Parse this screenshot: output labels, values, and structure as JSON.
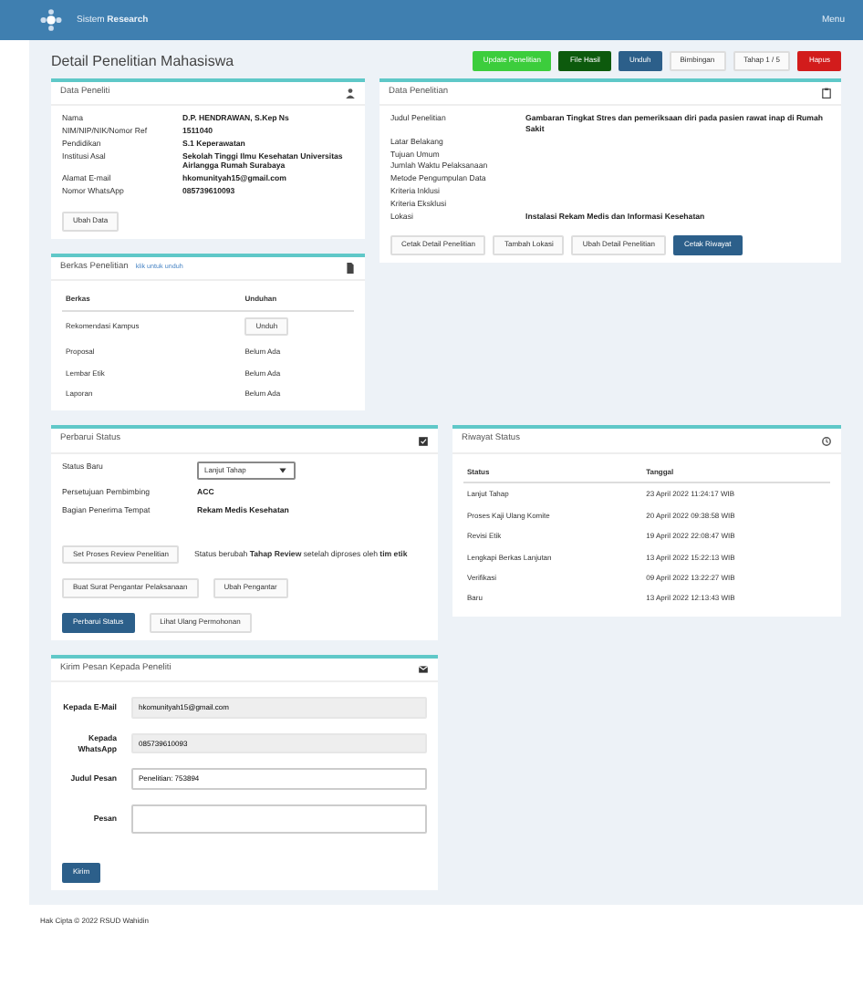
{
  "navbar": {
    "brand": "Sistem",
    "brand_bold": "Research",
    "menu": "Menu"
  },
  "page_title": "Detail Penelitian Mahasiswa",
  "actions": [
    {
      "label": "Update Penelitian",
      "kind": "success"
    },
    {
      "label": "File Hasil",
      "kind": "dark-success"
    },
    {
      "label": "Unduh",
      "kind": "primary"
    },
    {
      "label": "Bimbingan",
      "kind": "light"
    },
    {
      "label": "Tahap 1 / 5",
      "kind": "light"
    },
    {
      "label": "Hapus",
      "kind": "danger"
    }
  ],
  "researcher": {
    "title": "Data Peneliti",
    "fields": [
      {
        "label": "Nama",
        "value": "D.P. HENDRAWAN, S.Kep Ns"
      },
      {
        "label": "NIM/NIP/NIK/Nomor Ref",
        "value": "1511040"
      },
      {
        "label": "Pendidikan",
        "value": "S.1 Keperawatan"
      },
      {
        "label": "Institusi Asal",
        "value": "Sekolah Tinggi Ilmu Kesehatan Universitas Airlangga Rumah Surabaya"
      },
      {
        "label": "Alamat E-mail",
        "value": "hkomunityah15@gmail.com"
      },
      {
        "label": "Nomor WhatsApp",
        "value": "085739610093"
      }
    ],
    "edit_button": "Ubah Data"
  },
  "research": {
    "title": "Data Penelitian",
    "fields": [
      {
        "label": "Judul Penelitian",
        "value": "Gambaran Tingkat Stres dan pemeriksaan diri pada pasien rawat inap di Rumah Sakit"
      },
      {
        "label": "Latar Belakang"
      },
      {
        "label": "Tujuan Umum"
      },
      {
        "label": "Jumlah Waktu Pelaksanaan"
      },
      {
        "label": "Metode Pengumpulan Data"
      },
      {
        "label": "Kriteria Inklusi"
      },
      {
        "label": "Kriteria Eksklusi"
      },
      {
        "label": "Lokasi",
        "value": "Instalasi Rekam Medis dan Informasi Kesehatan"
      }
    ],
    "buttons": [
      {
        "label": "Cetak Detail Penelitian",
        "kind": "light"
      },
      {
        "label": "Tambah Lokasi",
        "kind": "light"
      },
      {
        "label": "Ubah Detail Penelitian",
        "kind": "light"
      },
      {
        "label": "Cetak Riwayat",
        "kind": "primary"
      }
    ]
  },
  "documents": {
    "title": "Berkas Penelitian",
    "subtitle": "klik untuk unduh",
    "columns": [
      "Berkas",
      "Unduhan"
    ],
    "rows": [
      {
        "name": "Rekomendasi Kampus",
        "file": "Unduh",
        "kind": "button"
      },
      {
        "name": "Proposal",
        "file": "Belum Ada",
        "kind": "text"
      },
      {
        "name": "Lembar Etik",
        "file": "Belum Ada",
        "kind": "text"
      },
      {
        "name": "Laporan",
        "file": "Belum Ada",
        "kind": "text"
      }
    ]
  },
  "status_update": {
    "title": "Perbarui Status",
    "select_label": "Status Baru",
    "select_value": "Lanjut Tahap",
    "fields": [
      {
        "label": "Persetujuan Pembimbing",
        "value": "ACC"
      },
      {
        "label": "Bagian Penerima Tempat",
        "value": "Rekam Medis Kesehatan"
      }
    ],
    "approve_button": "Set Proses Review Penelitian",
    "note": "Status berubah **Tahap Review** setelah diproses oleh **tim etik**",
    "letter_button": "Buat Surat Pengantar Pelaksanaan",
    "consent_button": "Ubah Pengantar",
    "save_button": "Perbarui Status",
    "history_button": "Lihat Ulang Permohonan"
  },
  "history": {
    "title": "Riwayat Status",
    "columns": [
      "Status",
      "Tanggal"
    ],
    "rows": [
      [
        "Lanjut Tahap",
        "23 April 2022 11:24:17 WIB"
      ],
      [
        "Proses Kaji Ulang Komite",
        "20 April 2022 09:38:58 WIB"
      ],
      [
        "Revisi Etik",
        "19 April 2022 22:08:47 WIB"
      ],
      [
        "Lengkapi Berkas Lanjutan",
        "13 April 2022 15:22:13 WIB"
      ],
      [
        "Verifikasi",
        "09 April 2022 13:22:27 WIB"
      ],
      [
        "Baru",
        "13 April 2022 12:13:43 WIB"
      ]
    ]
  },
  "message": {
    "title": "Kirim Pesan Kepada Peneliti",
    "fields": [
      {
        "label": "Kepada E-Mail",
        "value": "hkomunityah15@gmail.com",
        "kind": "readonly"
      },
      {
        "label": "Kepada WhatsApp",
        "value": "085739610093",
        "kind": "readonly"
      },
      {
        "label": "Judul Pesan",
        "value": "Penelitian: 753894",
        "kind": "input"
      },
      {
        "label": "Pesan",
        "kind": "textarea"
      }
    ],
    "send_button": "Kirim"
  },
  "footer": "Hak Cipta © 2022 RSUD Wahidin"
}
